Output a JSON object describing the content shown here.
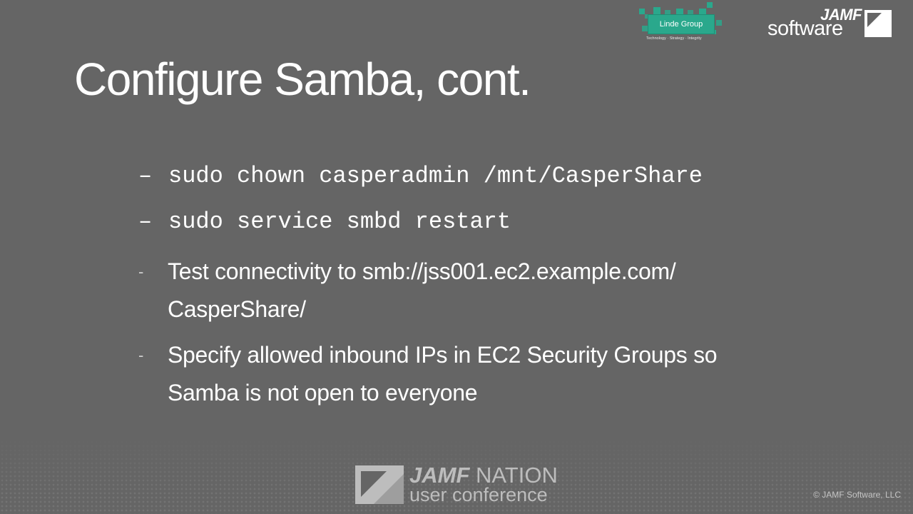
{
  "slide": {
    "title": "Configure Samba, cont.",
    "code_bullets": [
      {
        "dash": "–",
        "text": "sudo chown casperadmin /mnt/CasperShare"
      },
      {
        "dash": "–",
        "text": "sudo service smbd restart"
      }
    ],
    "text_bullets": [
      {
        "dash": "-",
        "lines": [
          "Test connectivity to smb://jss001.ec2.example.com/",
          "CasperShare/"
        ]
      },
      {
        "dash": "-",
        "lines": [
          "Specify allowed inbound IPs in EC2 Security Groups so",
          "Samba is not open to everyone"
        ]
      }
    ]
  },
  "logos": {
    "linde": {
      "name": "Linde Group",
      "tagline": "Technology · Strategy · Integrity",
      "color": "#2aa88c"
    },
    "jamf_software": {
      "jamf": "JAMF",
      "software": "software",
      "icon": "jamf-mark-icon"
    },
    "jamf_nation": {
      "jamf": "JAMF",
      "nation": "NATION",
      "subtitle": "user conference",
      "icon": "jamf-nation-mark-icon"
    }
  },
  "footer": {
    "copyright": "© JAMF Software, LLC"
  },
  "colors": {
    "background": "#656565",
    "text": "#ffffff",
    "accent_teal": "#2aa88c"
  }
}
